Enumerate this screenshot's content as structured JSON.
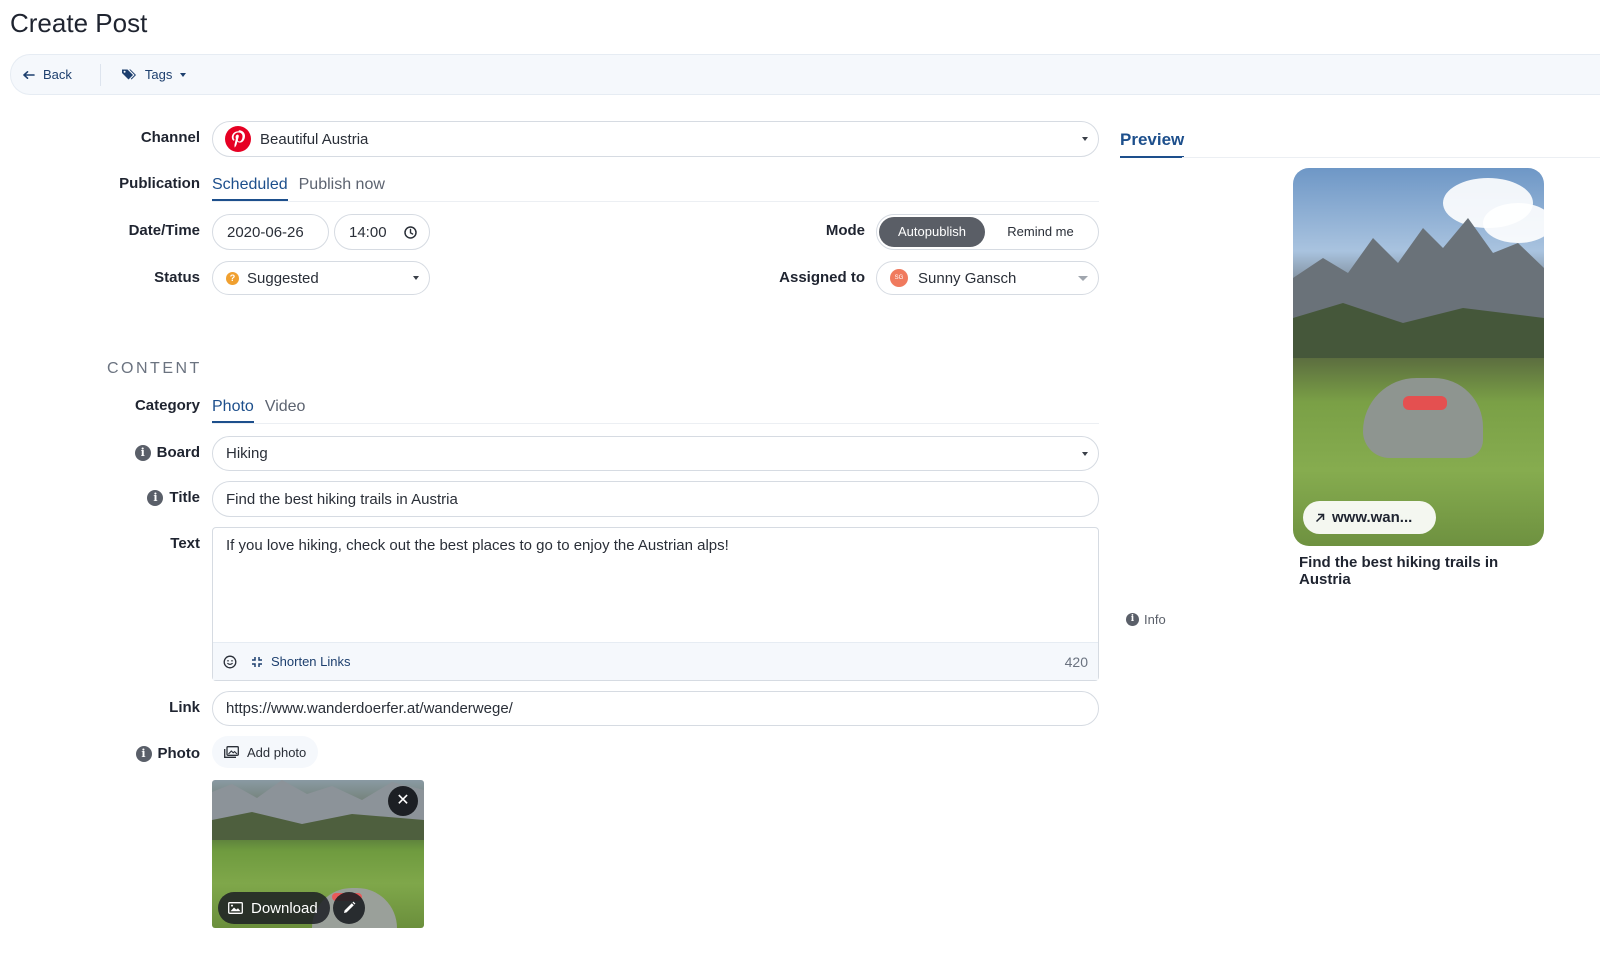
{
  "page_title": "Create Post",
  "toolbar": {
    "back_label": "Back",
    "tags_label": "Tags"
  },
  "labels": {
    "channel": "Channel",
    "publication": "Publication",
    "datetime": "Date/Time",
    "status": "Status",
    "mode": "Mode",
    "assigned_to": "Assigned to",
    "category": "Category",
    "board": "Board",
    "title": "Title",
    "text": "Text",
    "link": "Link",
    "photo": "Photo"
  },
  "channel": {
    "value": "Beautiful Austria"
  },
  "publication_tabs": [
    "Scheduled",
    "Publish now"
  ],
  "date": "2020-06-26",
  "time": "14:00",
  "status": {
    "value": "Suggested",
    "color": "#f0a030"
  },
  "mode_options": [
    "Autopublish",
    "Remind me"
  ],
  "assignee": {
    "initials": "SG",
    "name": "Sunny Gansch",
    "color": "#f07a5e"
  },
  "content_section": "CONTENT",
  "category_tabs": [
    "Photo",
    "Video"
  ],
  "board": "Hiking",
  "title_value": "Find the best hiking trails in Austria",
  "text_value": "If you love hiking, check out the best places to go to enjoy the Austrian alps!",
  "text_footer": {
    "shorten_links": "Shorten Links",
    "count": "420"
  },
  "link_value": "https://www.wanderdoerfer.at/wanderwege/",
  "add_photo_label": "Add photo",
  "thumbnail": {
    "download_label": "Download"
  },
  "preview": {
    "tab_label": "Preview",
    "link_text": "www.wan...",
    "pin_title": "Find the best hiking trails in Austria",
    "info_label": "Info"
  },
  "colors": {
    "accent": "#1d4f8c",
    "pinterest": "#e60023"
  }
}
